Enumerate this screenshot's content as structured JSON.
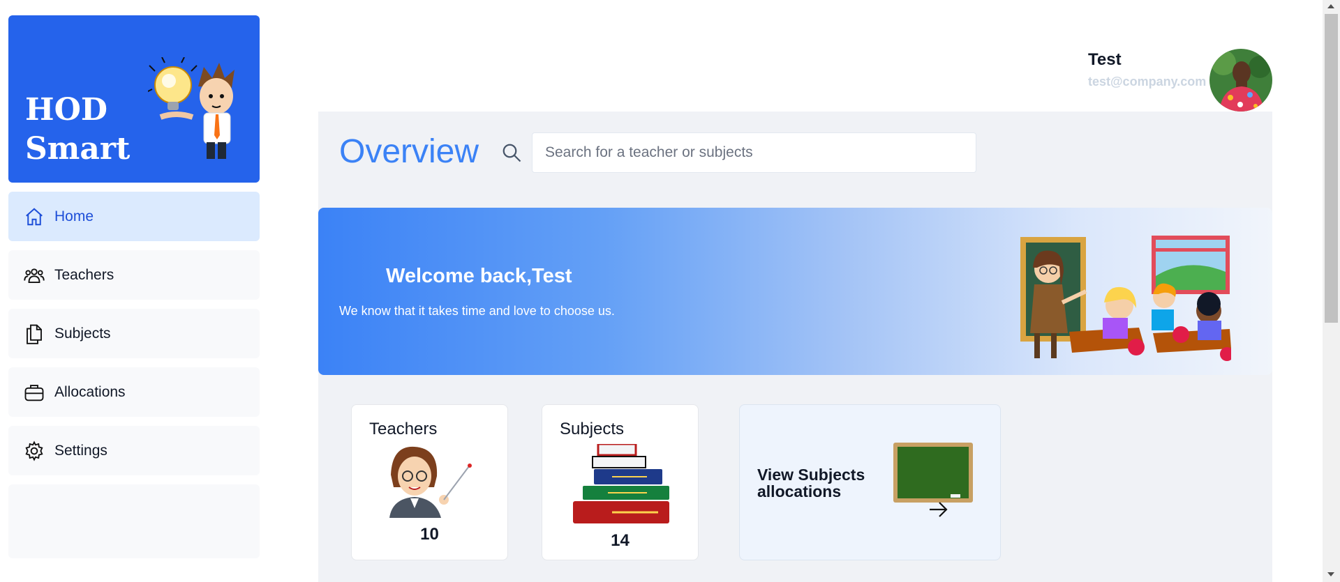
{
  "sidebar": {
    "brand": {
      "line1": "HOD",
      "line2": "Smart"
    },
    "items": [
      {
        "label": "Home",
        "icon": "home-icon",
        "active": true
      },
      {
        "label": "Teachers",
        "icon": "users-icon",
        "active": false
      },
      {
        "label": "Subjects",
        "icon": "documents-icon",
        "active": false
      },
      {
        "label": "Allocations",
        "icon": "briefcase-icon",
        "active": false
      },
      {
        "label": "Settings",
        "icon": "gear-icon",
        "active": false
      }
    ]
  },
  "user": {
    "name": "Test",
    "email": "test@company.com"
  },
  "main": {
    "title": "Overview",
    "search": {
      "placeholder": "Search for a teacher or subjects"
    },
    "banner": {
      "heading": "Welcome back,Test",
      "subtext": "We know that it takes time and love to choose us."
    },
    "cards": {
      "teachers": {
        "title": "Teachers",
        "count": "10"
      },
      "subjects": {
        "title": "Subjects",
        "count": "14"
      },
      "allocations": {
        "title": "View Subjects allocations"
      }
    }
  },
  "colors": {
    "brand": "#2563eb",
    "accent": "#3b82f6",
    "active_bg": "#dbeafe"
  }
}
